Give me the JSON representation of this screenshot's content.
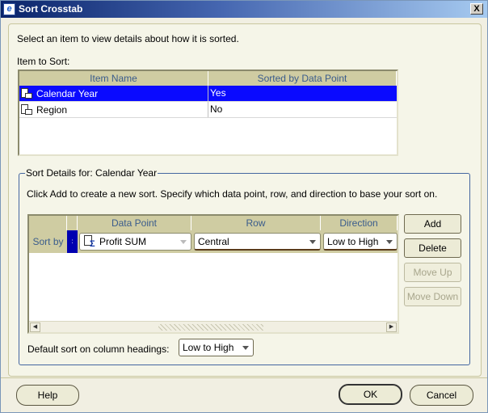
{
  "window": {
    "title": "Sort Crosstab",
    "close_label": "X"
  },
  "intro_text": "Select an item to view details about how it is sorted.",
  "item_to_sort": {
    "label": "Item to Sort:",
    "columns": [
      "Item Name",
      "Sorted by Data Point"
    ],
    "rows": [
      {
        "name": "Calendar Year",
        "sorted": "Yes",
        "selected": true
      },
      {
        "name": "Region",
        "sorted": "No",
        "selected": false
      }
    ]
  },
  "sort_details": {
    "legend": "Sort Details for: Calendar Year",
    "description": "Click Add to create a new sort. Specify which data point, row, and direction to base your sort on.",
    "grid": {
      "columns": [
        "",
        "",
        "Data Point",
        "Row",
        "Direction"
      ],
      "rows": [
        {
          "label": "Sort by",
          "data_point": "Profit SUM",
          "row": "Central",
          "direction": "Low to High"
        }
      ]
    },
    "buttons": {
      "add": "Add",
      "delete": "Delete",
      "move_up": "Move Up",
      "move_down": "Move Down"
    },
    "default_sort_label": "Default sort on column headings:",
    "default_sort_value": "Low to High"
  },
  "footer": {
    "help": "Help",
    "ok": "OK",
    "cancel": "Cancel"
  }
}
